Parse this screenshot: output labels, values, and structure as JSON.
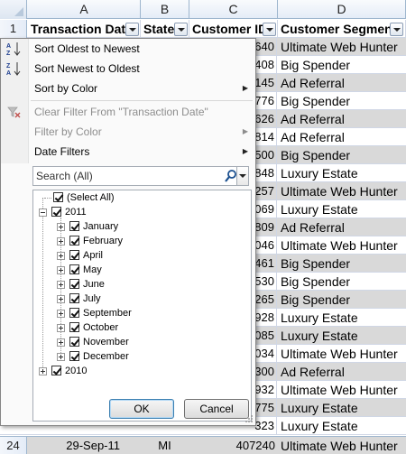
{
  "columns": [
    {
      "letter": "A",
      "header": "Transaction Date"
    },
    {
      "letter": "B",
      "header": "State"
    },
    {
      "letter": "C",
      "header": "Customer ID"
    },
    {
      "letter": "D",
      "header": "Customer Segment"
    }
  ],
  "header_row_number": "1",
  "rows": [
    {
      "id": "640",
      "segment": "Ultimate Web Hunter",
      "shaded": true
    },
    {
      "id": "408",
      "segment": "Big Spender",
      "shaded": false
    },
    {
      "id": "145",
      "segment": "Ad Referral",
      "shaded": true
    },
    {
      "id": "776",
      "segment": "Big Spender",
      "shaded": false
    },
    {
      "id": "626",
      "segment": "Ad Referral",
      "shaded": true
    },
    {
      "id": "814",
      "segment": "Ad Referral",
      "shaded": false
    },
    {
      "id": "500",
      "segment": "Big Spender",
      "shaded": true
    },
    {
      "id": "848",
      "segment": "Luxury Estate",
      "shaded": false
    },
    {
      "id": "257",
      "segment": "Ultimate Web Hunter",
      "shaded": true
    },
    {
      "id": "069",
      "segment": "Luxury Estate",
      "shaded": false
    },
    {
      "id": "809",
      "segment": "Ad Referral",
      "shaded": true
    },
    {
      "id": "046",
      "segment": "Ultimate Web Hunter",
      "shaded": false
    },
    {
      "id": "461",
      "segment": "Big Spender",
      "shaded": true
    },
    {
      "id": "530",
      "segment": "Big Spender",
      "shaded": false
    },
    {
      "id": "265",
      "segment": "Big Spender",
      "shaded": true
    },
    {
      "id": "928",
      "segment": "Luxury Estate",
      "shaded": false
    },
    {
      "id": "085",
      "segment": "Luxury Estate",
      "shaded": true
    },
    {
      "id": "034",
      "segment": "Ultimate Web Hunter",
      "shaded": false
    },
    {
      "id": "300",
      "segment": "Ad Referral",
      "shaded": true
    },
    {
      "id": "932",
      "segment": "Ultimate Web Hunter",
      "shaded": false
    },
    {
      "id": "775",
      "segment": "Luxury Estate",
      "shaded": true
    },
    {
      "id": "323",
      "segment": "Luxury Estate",
      "shaded": false
    }
  ],
  "last_row": {
    "number": "24",
    "date": "29-Sep-11",
    "state": "MI",
    "id": "407240",
    "segment": "Ultimate Web Hunter"
  },
  "menu": {
    "sort_asc": "Sort Oldest to Newest",
    "sort_desc": "Sort Newest to Oldest",
    "sort_color": "Sort by Color",
    "clear_filter": "Clear Filter From \"Transaction Date\"",
    "filter_color": "Filter by Color",
    "date_filters": "Date Filters",
    "search_placeholder": "Search (All)",
    "ok": "OK",
    "cancel": "Cancel"
  },
  "tree": {
    "select_all": "(Select All)",
    "years": [
      {
        "label": "2011",
        "expanded": true,
        "months": [
          "January",
          "February",
          "April",
          "May",
          "June",
          "July",
          "September",
          "October",
          "November",
          "December"
        ]
      },
      {
        "label": "2010",
        "expanded": false,
        "months": []
      }
    ]
  }
}
